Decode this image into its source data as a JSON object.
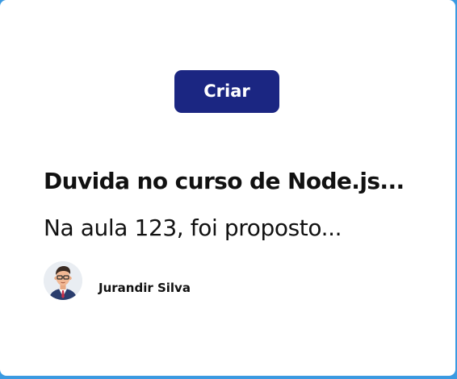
{
  "toolbar": {
    "create_label": "Criar"
  },
  "post": {
    "title": "Duvida no curso de Node.js...",
    "excerpt": "Na aula 123, foi proposto...",
    "author": {
      "name": "Jurandir Silva",
      "avatar_icon": "man-with-glasses-avatar"
    }
  },
  "colors": {
    "accent": "#1b2682",
    "card_background": "#ffffff",
    "frame_border": "#3b9ae1",
    "text": "#111111"
  }
}
